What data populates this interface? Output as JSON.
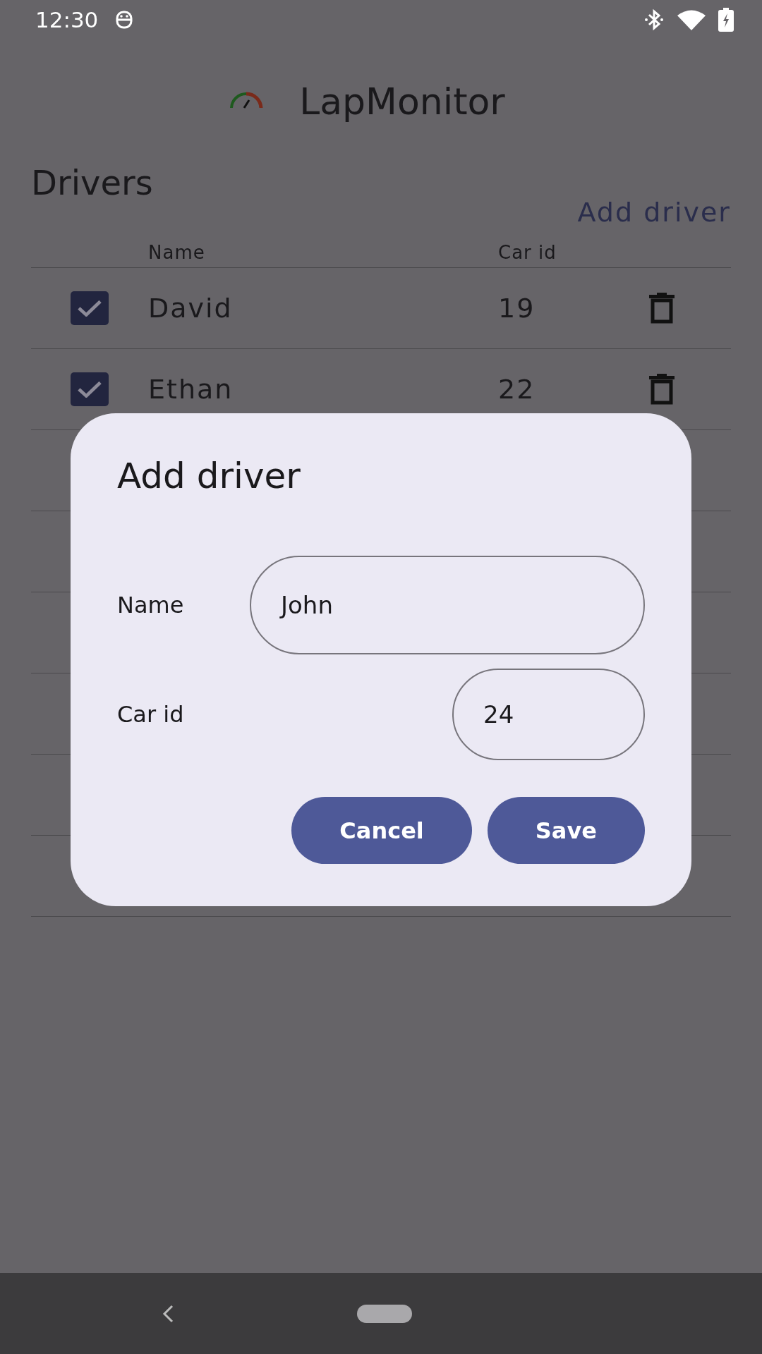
{
  "status_bar": {
    "time": "12:30"
  },
  "app_bar": {
    "title": "LapMonitor"
  },
  "page": {
    "title": "Drivers",
    "add_link": "Add driver"
  },
  "table": {
    "columns": [
      "Name",
      "Car id"
    ],
    "rows": [
      {
        "name": "David",
        "car_id": "19",
        "checked": true
      },
      {
        "name": "Ethan",
        "car_id": "22",
        "checked": true
      }
    ]
  },
  "dialog": {
    "title": "Add driver",
    "fields": [
      {
        "label": "Name",
        "value": "John",
        "kind": "wide"
      },
      {
        "label": "Car id",
        "value": "24",
        "kind": "narrow"
      }
    ],
    "buttons": [
      "Cancel",
      "Save"
    ]
  }
}
